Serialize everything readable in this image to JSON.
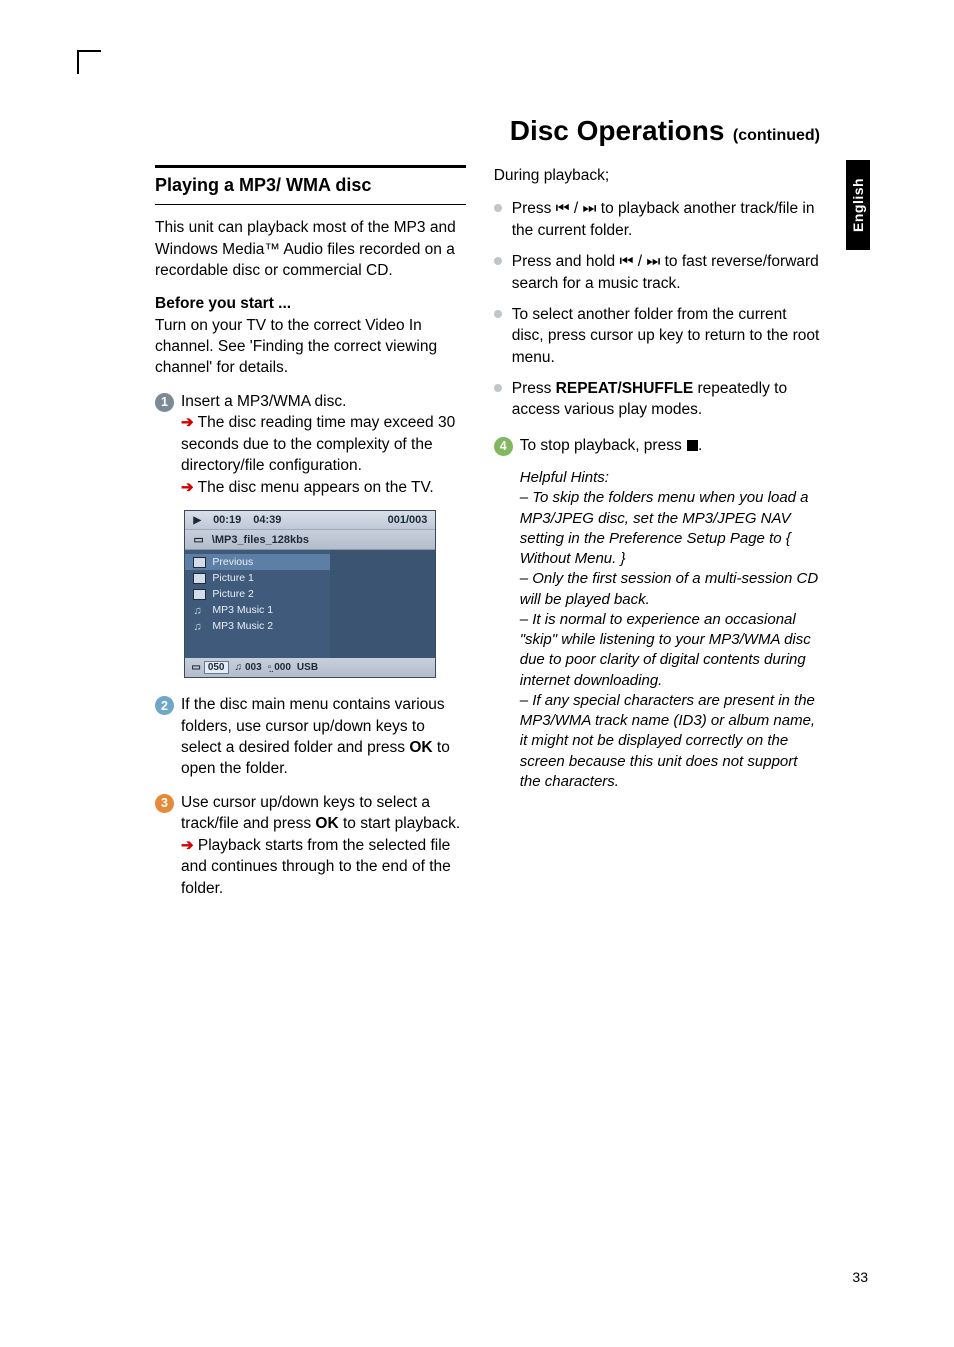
{
  "sidetab": "English",
  "page_number": "33",
  "title": "Disc Operations",
  "title_cont": "(continued)",
  "section_heading": "Playing a MP3/ WMA disc",
  "intro_para": "This unit can playback most of the MP3 and Windows Media™ Audio files recorded on a recordable disc or commercial CD.",
  "before_label": "Before you start ...",
  "before_text": "Turn on your TV to the correct Video In channel.  See 'Finding the correct viewing channel' for details.",
  "step1_line1": "Insert a MP3/WMA disc.",
  "step1_line2": " The disc reading time may exceed 30 seconds due to the complexity of the directory/file configuration.",
  "step1_line3": " The disc menu appears on the TV.",
  "step2": "If the disc main menu contains various folders, use cursor up/down keys to select a desired folder and press ",
  "step2_ok": "OK",
  "step2_tail": " to open the folder.",
  "step3a": "Use cursor up/down keys to select a track/file and press ",
  "step3_ok": "OK",
  "step3b": " to start playback.",
  "step3_line2": " Playback starts from the selected file and continues through to the end of the folder.",
  "right_intro": "During playback;",
  "b1a": "Press ",
  "b1b": " to playback another track/file in the current folder.",
  "b2a": "Press and hold ",
  "b2b": " to fast reverse/forward search for a music track.",
  "b3": "To select another folder from the current disc, press cursor up key to return to the root menu.",
  "b4a": "Press ",
  "b4_repeat": "REPEAT/SHUFFLE",
  "b4b": " repeatedly to access various play modes.",
  "step4a": "To stop playback, press ",
  "step4b": ".",
  "hints_label": "Helpful Hints:",
  "hint1a": "–  To skip the folders menu when you load a MP3/JPEG disc, set the MP3/JPEG NAV setting in the Preference Setup Page to",
  "hint1b": "{ Without Menu. }",
  "hint2": "–  Only the first session of a multi-session CD will be played back.",
  "hint3": "–  It is normal to experience an occasional \"skip\" while listening to your MP3/WMA disc due to poor clarity of digital contents during internet downloading.",
  "hint4": "–  If any special characters are present in the MP3/WMA track name (ID3) or album name, it might not be displayed correctly on the screen because this unit does not support the characters.",
  "skip_glyph": "⏮ / ⏭",
  "disc_menu": {
    "time_current": "00:19",
    "time_total": "04:39",
    "track_counter": "001/003",
    "path": "\\MP3_files_128kbs",
    "rows": [
      "Previous",
      "Picture 1",
      "Picture 2",
      "MP3 Music 1",
      "MP3 Music 2"
    ],
    "footer_folders": "050",
    "footer_tracks": "003",
    "footer_images": "000",
    "footer_mode": "USB"
  }
}
